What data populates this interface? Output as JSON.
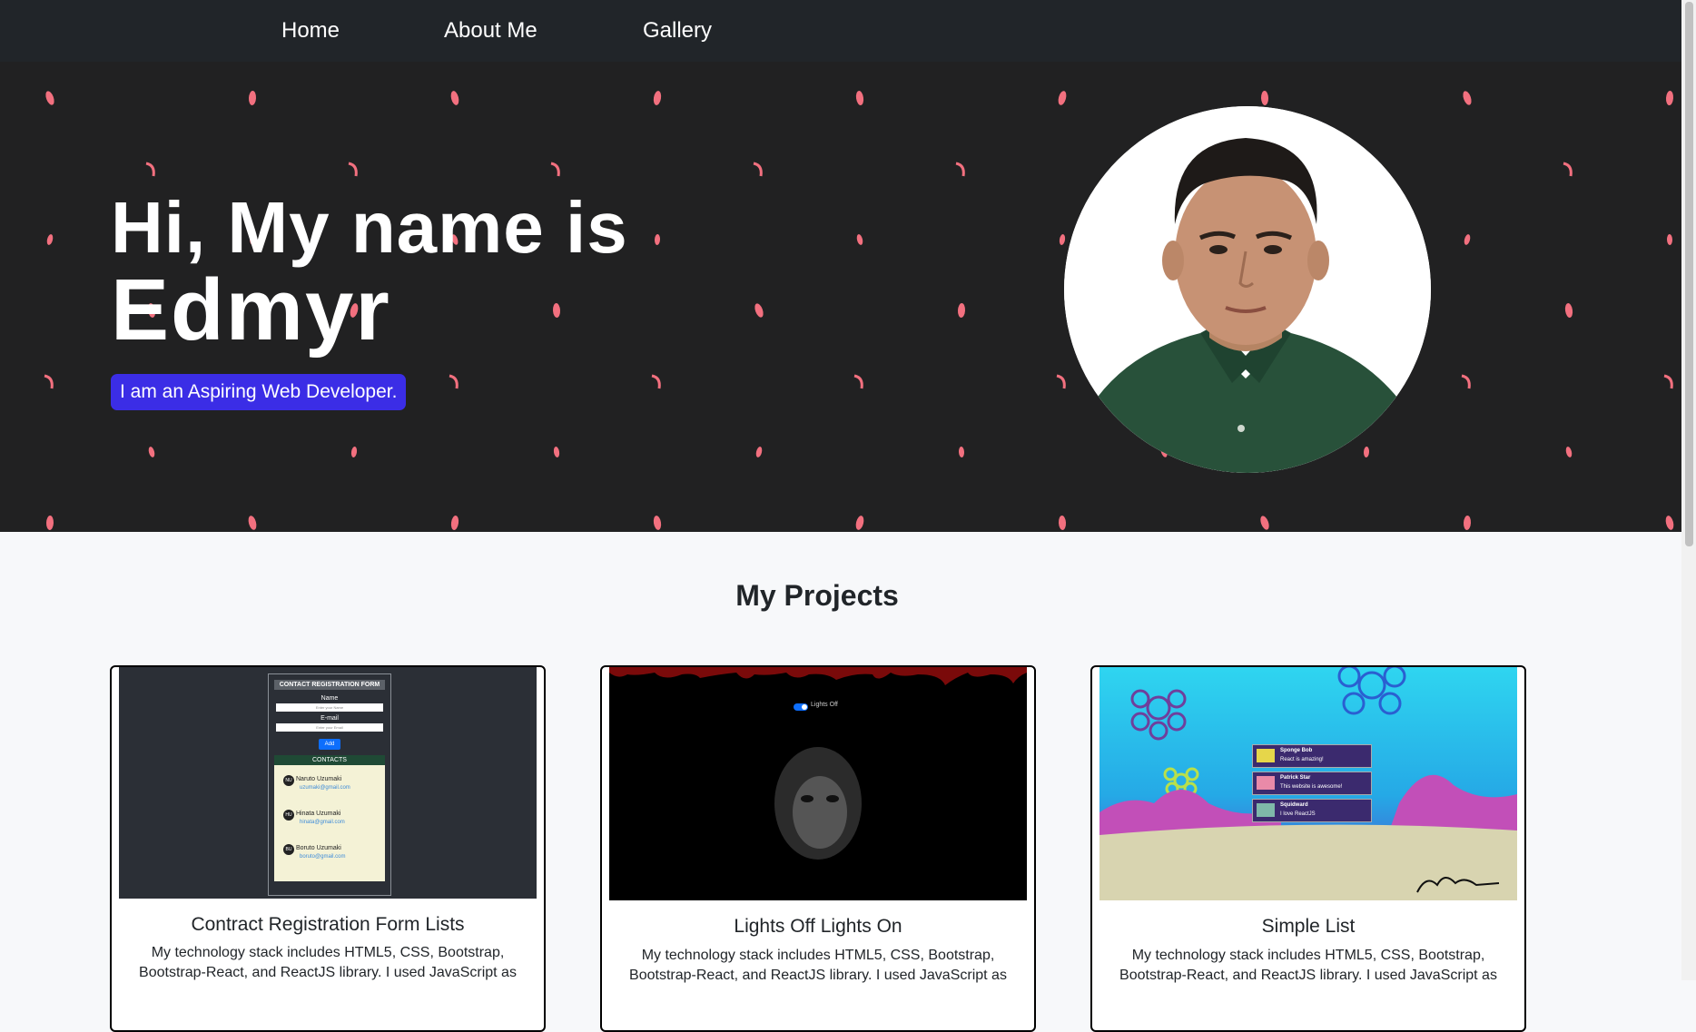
{
  "nav": {
    "items": [
      {
        "label": "Home"
      },
      {
        "label": "About Me"
      },
      {
        "label": "Gallery"
      }
    ]
  },
  "hero": {
    "greeting": "Hi, My name is",
    "name": "Edmyr",
    "tagline": "I am an Aspiring Web Developer.",
    "petal_color": "#f2707f"
  },
  "projects": {
    "title": "My Projects",
    "cards": [
      {
        "title": "Contract Registration Form Lists",
        "description": "My technology stack includes HTML5, CSS, Bootstrap, Bootstrap-React, and ReactJS library. I used JavaScript as",
        "screenshot": {
          "form_title": "CONTACT REGISTRATION FORM",
          "name_label": "Name",
          "name_placeholder": "Enter your Name",
          "email_label": "E-mail",
          "email_placeholder": "Enter your Email",
          "add_button": "Add",
          "contacts_header": "CONTACTS",
          "contacts": [
            {
              "initials": "NU",
              "name": "Naruto Uzumaki",
              "email": "uzumaki@gmail.com"
            },
            {
              "initials": "HU",
              "name": "Hinata Uzumaki",
              "email": "hinata@gmail.com"
            },
            {
              "initials": "BU",
              "name": "Boruto Uzumaki",
              "email": "boruto@gmail.com"
            }
          ]
        }
      },
      {
        "title": "Lights Off Lights On",
        "description": "My technology stack includes HTML5, CSS, Bootstrap, Bootstrap-React, and ReactJS library. I used JavaScript as",
        "screenshot": {
          "toggle_label": "Lights Off"
        }
      },
      {
        "title": "Simple List",
        "description": "My technology stack includes HTML5, CSS, Bootstrap, Bootstrap-React, and ReactJS library. I used JavaScript as",
        "screenshot": {
          "items": [
            {
              "name": "Sponge Bob",
              "message": "React is amazing!"
            },
            {
              "name": "Patrick Star",
              "message": "This website is awesome!"
            },
            {
              "name": "Squidward",
              "message": "I love ReactJS"
            }
          ]
        }
      }
    ]
  },
  "colors": {
    "navbar": "#212529",
    "hero_bg": "#212122",
    "tagline_bg": "#3b2de6",
    "page_bg": "#f7f8fa"
  }
}
